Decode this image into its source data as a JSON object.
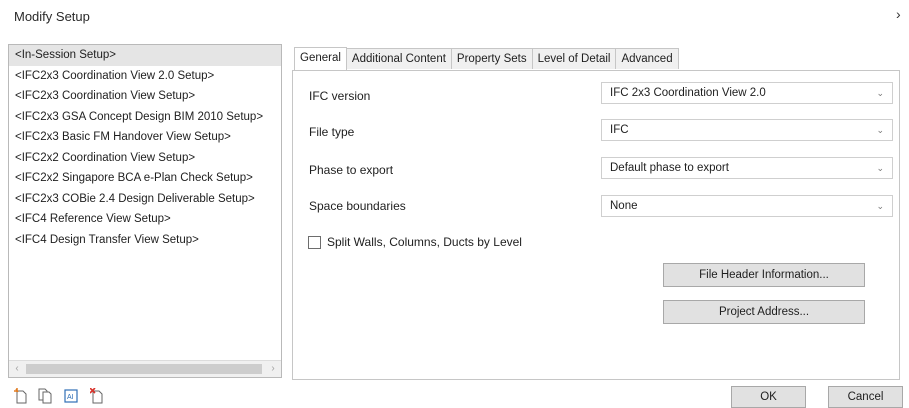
{
  "dialog": {
    "title": "Modify Setup",
    "close_glyph": "›"
  },
  "setups": [
    {
      "label": "<In-Session Setup>",
      "selected": true
    },
    {
      "label": "<IFC2x3 Coordination View 2.0 Setup>"
    },
    {
      "label": "<IFC2x3 Coordination View Setup>"
    },
    {
      "label": "<IFC2x3 GSA Concept Design BIM 2010 Setup>"
    },
    {
      "label": "<IFC2x3 Basic FM Handover View Setup>"
    },
    {
      "label": "<IFC2x2 Coordination View Setup>"
    },
    {
      "label": "<IFC2x2 Singapore BCA e-Plan Check Setup>"
    },
    {
      "label": "<IFC2x3 COBie 2.4 Design Deliverable Setup>"
    },
    {
      "label": "<IFC4 Reference View Setup>"
    },
    {
      "label": "<IFC4 Design Transfer View Setup>"
    }
  ],
  "tabs": [
    "General",
    "Additional Content",
    "Property Sets",
    "Level of Detail",
    "Advanced"
  ],
  "general": {
    "ifc_version": {
      "label": "IFC version",
      "value": "IFC 2x3 Coordination View 2.0"
    },
    "file_type": {
      "label": "File type",
      "value": "IFC"
    },
    "phase": {
      "label": "Phase to export",
      "value": "Default phase to export"
    },
    "space_boundaries": {
      "label": "Space boundaries",
      "value": "None"
    },
    "split_walls": {
      "label": "Split Walls, Columns, Ducts by Level",
      "checked": false
    },
    "file_header_button": "File Header Information...",
    "project_address_button": "Project Address..."
  },
  "footer": {
    "ok": "OK",
    "cancel": "Cancel"
  },
  "icons": [
    "new-setup-icon",
    "duplicate-setup-icon",
    "rename-setup-icon",
    "delete-setup-icon"
  ],
  "colors": {
    "icon_orange": "#e07a1f",
    "icon_blue": "#2f6fb6",
    "icon_red": "#d9332b"
  }
}
